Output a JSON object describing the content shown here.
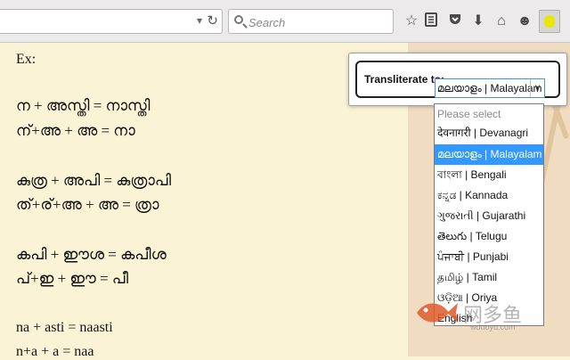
{
  "toolbar": {
    "reload_icon": "reload-icon",
    "search": {
      "placeholder": "Search",
      "value": ""
    },
    "icons": [
      "star-icon",
      "reading-list-icon",
      "pocket-icon",
      "download-icon",
      "home-icon",
      "smiley-icon",
      "extension-icon"
    ]
  },
  "content": {
    "lines": [
      "Ex:",
      "ന + അസ്തി = നാസ്തി",
      "ന്+അ + അ = നാ",
      "കുത്ര + അപി = കുത്രാപി",
      "ത്+ര്+അ + അ = ത്രാ",
      "കപി + ഈശ = കപീശ",
      "പ്+ഇ + ഈ = പീ",
      "na + asti = naasti",
      "n+a + a = naa"
    ]
  },
  "popup": {
    "label": "Transliterate to:",
    "selected": "മലയാളം | Malayalam",
    "options": [
      "Please select",
      "देवनागरी | Devanagri",
      "മലയാളം | Malayalam",
      "বাংলা | Bengali",
      "ಕನ್ನಡ | Kannada",
      "ગુજરાતી | Gujarathi",
      "తెలుగు | Telugu",
      "ਪੰਜਾਬੀ | Punjabi",
      "தமிழ் | Tamil",
      "ଓଡ଼ିଆ | Oriya",
      "English"
    ]
  },
  "watermark": {
    "text": "网多鱼",
    "url": "wduoyu.com"
  },
  "colors": {
    "page_bg": "#fbf3d6",
    "right_panel": "#f0dcc1",
    "selected_option": "#3399ff",
    "fish": "#e05a2a"
  }
}
